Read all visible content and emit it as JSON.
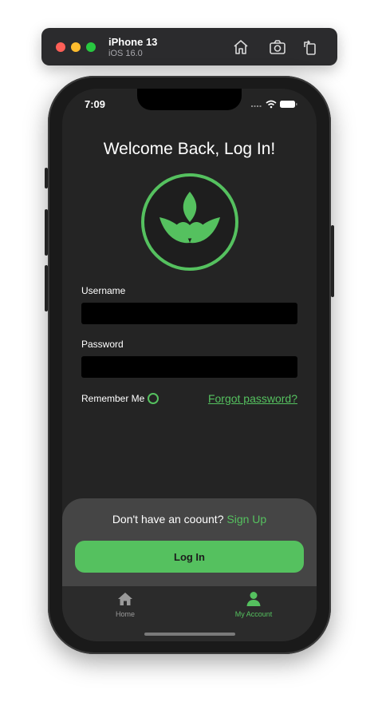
{
  "simulator": {
    "device_name": "iPhone 13",
    "os_version": "iOS 16.0",
    "icons": [
      "home-icon",
      "screenshot-icon",
      "rotate-icon"
    ]
  },
  "status_bar": {
    "time": "7:09",
    "icons": [
      "signal-icon",
      "wifi-icon",
      "battery-icon"
    ]
  },
  "login": {
    "title": "Welcome Back, Log In!",
    "logo_icon": "leaf-logo-icon",
    "username_label": "Username",
    "username_value": "",
    "password_label": "Password",
    "password_value": "",
    "remember_label": "Remember Me",
    "remember_checked": false,
    "forgot_link": "Forgot password?"
  },
  "bottom_sheet": {
    "signup_prompt": "Don't have an coount?",
    "signup_link": "Sign Up",
    "login_button": "Log In"
  },
  "tabbar": {
    "items": [
      {
        "label": "Home",
        "icon": "home-icon",
        "active": false
      },
      {
        "label": "My Account",
        "icon": "person-icon",
        "active": true
      }
    ]
  },
  "colors": {
    "accent": "#55c15f",
    "screen_bg": "#242424",
    "sheet_bg": "#454545",
    "input_bg": "#000000"
  }
}
